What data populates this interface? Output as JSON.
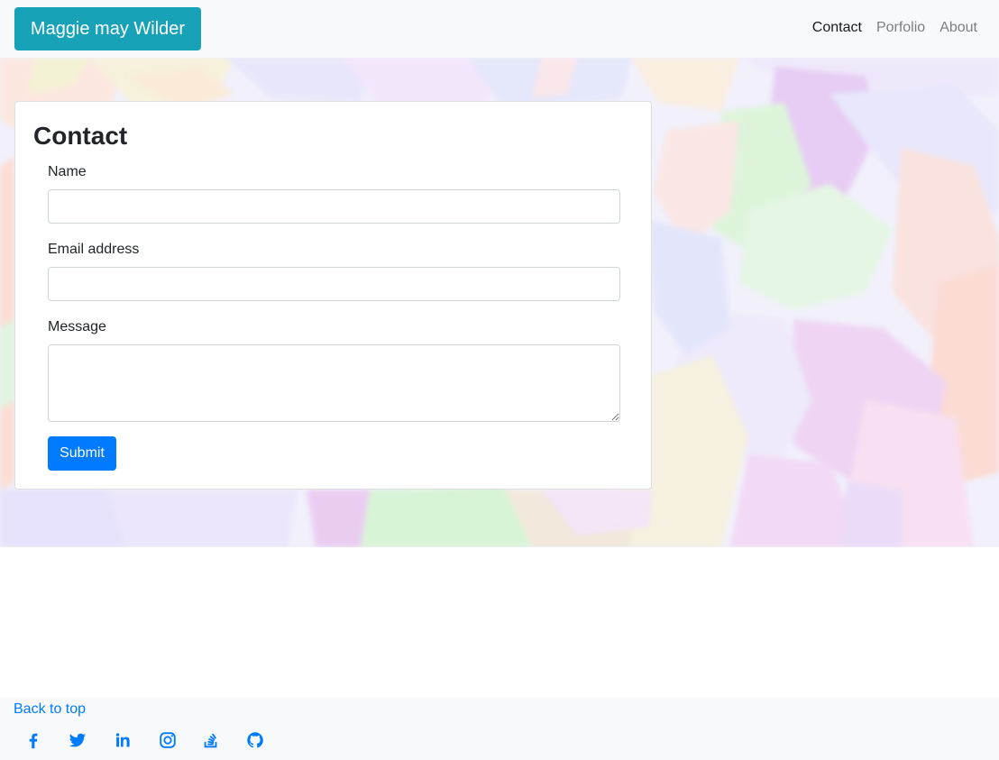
{
  "navbar": {
    "brand": "Maggie may Wilder",
    "links": [
      {
        "label": "Contact",
        "active": true
      },
      {
        "label": "Porfolio",
        "active": false
      },
      {
        "label": "About",
        "active": false
      }
    ]
  },
  "contact": {
    "title": "Contact",
    "name_label": "Name",
    "name_value": "",
    "email_label": "Email address",
    "email_value": "",
    "message_label": "Message",
    "message_value": "",
    "submit_label": "Submit"
  },
  "footer": {
    "back_to_top": "Back to top",
    "social_icons": [
      "facebook-icon",
      "twitter-icon",
      "linkedin-icon",
      "instagram-icon",
      "stackoverflow-icon",
      "github-icon"
    ]
  },
  "colors": {
    "brand_bg": "#17a2b8",
    "primary": "#007bff",
    "navbar_bg": "#f8f9fa"
  }
}
